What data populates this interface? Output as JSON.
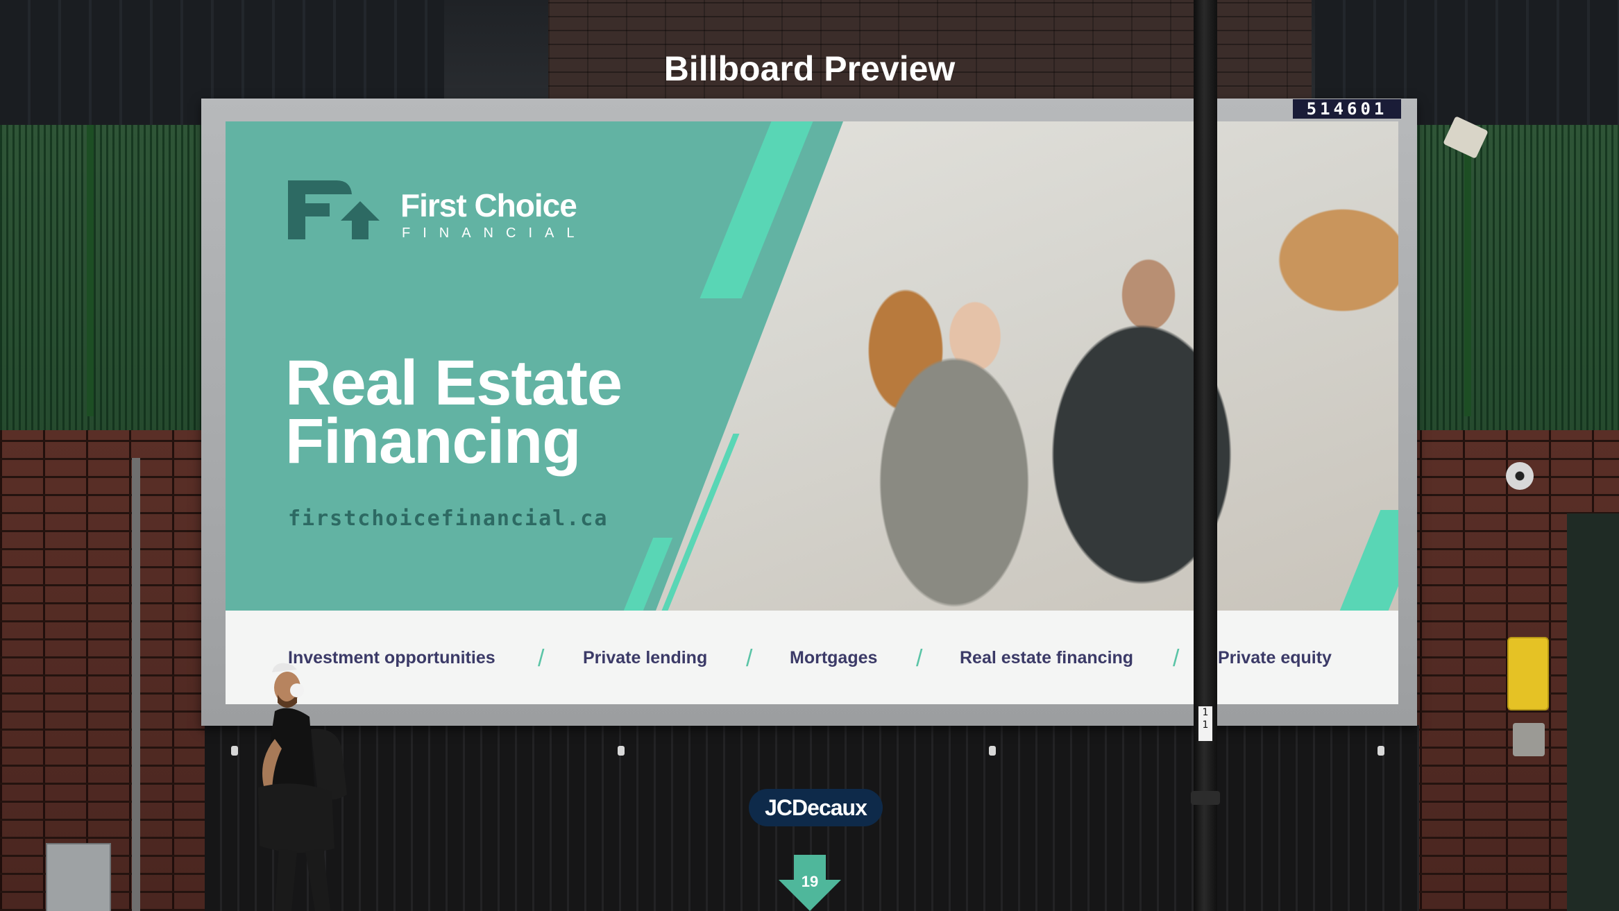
{
  "page": {
    "title": "Billboard Preview",
    "page_number": "19"
  },
  "billboard": {
    "panel_number": "514601",
    "brand": {
      "name": "First Choice",
      "subtitle": "FINANCIAL"
    },
    "headline": {
      "line1": "Real Estate",
      "line2": "Financing"
    },
    "website": "firstchoicefinancial.ca",
    "services": [
      "Investment opportunities",
      "Private lending",
      "Mortgages",
      "Real estate financing",
      "Private equity"
    ],
    "colors": {
      "teal": "#62b3a3",
      "accent": "#59d6b5",
      "dark_text": "#3b3a67"
    }
  },
  "street": {
    "operator_badge": "JCDecaux",
    "pole_label": "1\n1"
  }
}
